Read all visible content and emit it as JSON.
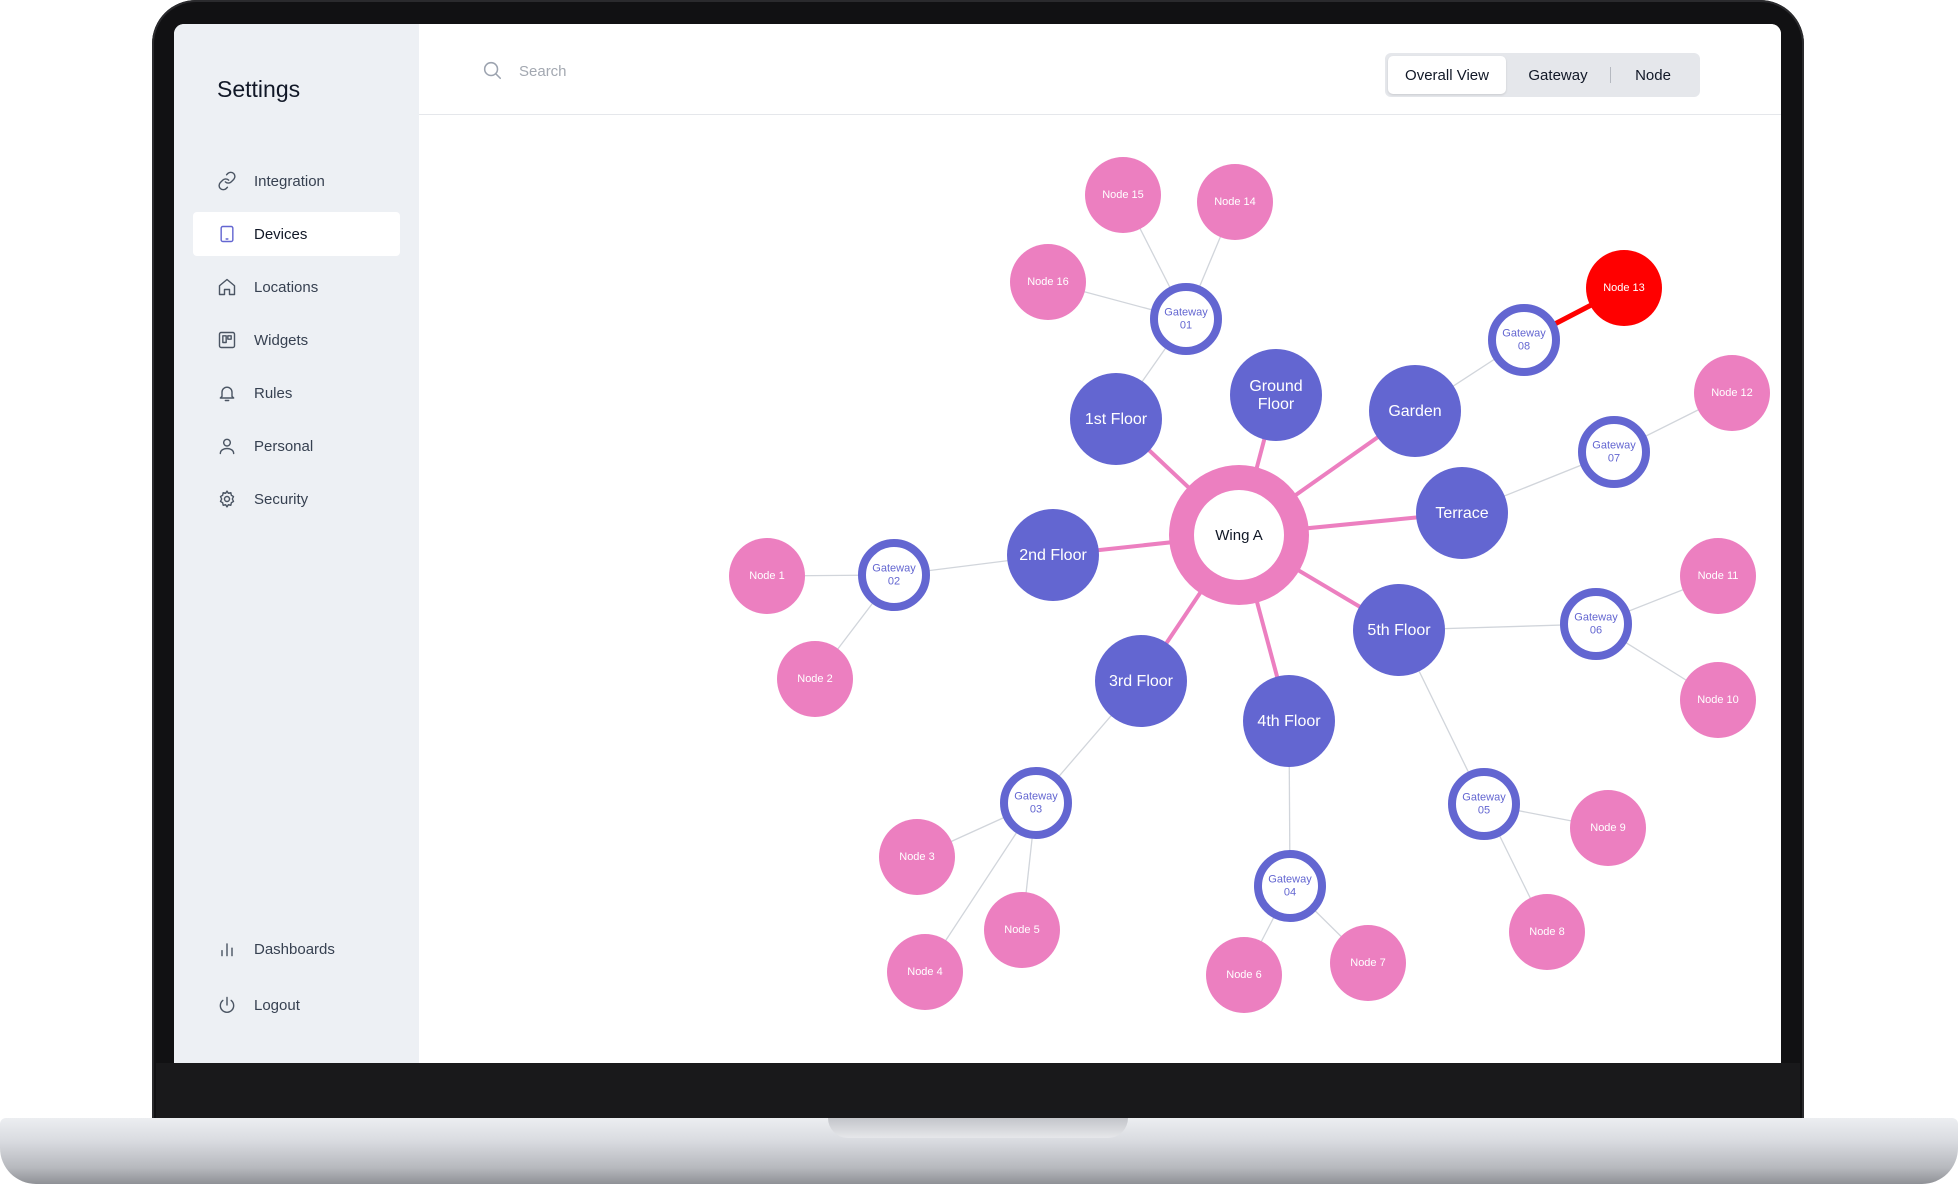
{
  "sidebar": {
    "title": "Settings",
    "items": [
      {
        "label": "Integration",
        "icon": "link-icon"
      },
      {
        "label": "Devices",
        "icon": "tablet-icon",
        "active": true
      },
      {
        "label": "Locations",
        "icon": "home-icon"
      },
      {
        "label": "Widgets",
        "icon": "widgets-icon"
      },
      {
        "label": "Rules",
        "icon": "bell-icon"
      },
      {
        "label": "Personal",
        "icon": "user-icon"
      },
      {
        "label": "Security",
        "icon": "gear-icon"
      }
    ],
    "bottom_items": [
      {
        "label": "Dashboards",
        "icon": "bar-chart-icon"
      },
      {
        "label": "Logout",
        "icon": "power-icon"
      }
    ]
  },
  "search": {
    "placeholder": "Search",
    "value": ""
  },
  "view_tabs": [
    {
      "label": "Overall View",
      "active": true
    },
    {
      "label": "Gateway",
      "active": false
    },
    {
      "label": "Node",
      "active": false
    }
  ],
  "colors": {
    "accent": "#6366D1",
    "hub": "#EC7FC0",
    "node": "#EC7FC0",
    "alert": "#FF0000",
    "sidebar_bg": "#EDF0F4"
  },
  "graph": {
    "hub": {
      "id": "wing-a",
      "label": "Wing A"
    },
    "areas": [
      {
        "id": "1st-floor",
        "lines": [
          "1st Floor"
        ]
      },
      {
        "id": "ground-floor",
        "lines": [
          "Ground",
          "Floor"
        ]
      },
      {
        "id": "garden",
        "lines": [
          "Garden"
        ]
      },
      {
        "id": "terrace",
        "lines": [
          "Terrace"
        ]
      },
      {
        "id": "5th-floor",
        "lines": [
          "5th Floor"
        ]
      },
      {
        "id": "4th-floor",
        "lines": [
          "4th Floor"
        ]
      },
      {
        "id": "3rd-floor",
        "lines": [
          "3rd Floor"
        ]
      },
      {
        "id": "2nd-floor",
        "lines": [
          "2nd Floor"
        ]
      }
    ],
    "gateways": [
      {
        "id": "gateway-01",
        "lines": [
          "Gateway",
          "01"
        ],
        "area": "1st-floor"
      },
      {
        "id": "gateway-02",
        "lines": [
          "Gateway",
          "02"
        ],
        "area": "2nd-floor"
      },
      {
        "id": "gateway-03",
        "lines": [
          "Gateway",
          "03"
        ],
        "area": "3rd-floor"
      },
      {
        "id": "gateway-04",
        "lines": [
          "Gateway",
          "04"
        ],
        "area": "4th-floor"
      },
      {
        "id": "gateway-05",
        "lines": [
          "Gateway",
          "05"
        ],
        "area": "5th-floor"
      },
      {
        "id": "gateway-06",
        "lines": [
          "Gateway",
          "06"
        ],
        "area": "5th-floor"
      },
      {
        "id": "gateway-07",
        "lines": [
          "Gateway",
          "07"
        ],
        "area": "terrace"
      },
      {
        "id": "gateway-08",
        "lines": [
          "Gateway",
          "08"
        ],
        "area": "garden"
      }
    ],
    "nodes": [
      {
        "id": "node-1",
        "label": "Node 1",
        "gateway": "gateway-02"
      },
      {
        "id": "node-2",
        "label": "Node 2",
        "gateway": "gateway-02"
      },
      {
        "id": "node-3",
        "label": "Node 3",
        "gateway": "gateway-03"
      },
      {
        "id": "node-4",
        "label": "Node 4",
        "gateway": "gateway-03"
      },
      {
        "id": "node-5",
        "label": "Node 5",
        "gateway": "gateway-03"
      },
      {
        "id": "node-6",
        "label": "Node 6",
        "gateway": "gateway-04"
      },
      {
        "id": "node-7",
        "label": "Node 7",
        "gateway": "gateway-04"
      },
      {
        "id": "node-8",
        "label": "Node 8",
        "gateway": "gateway-05"
      },
      {
        "id": "node-9",
        "label": "Node 9",
        "gateway": "gateway-05"
      },
      {
        "id": "node-10",
        "label": "Node 10",
        "gateway": "gateway-06"
      },
      {
        "id": "node-11",
        "label": "Node 11",
        "gateway": "gateway-06"
      },
      {
        "id": "node-12",
        "label": "Node 12",
        "gateway": "gateway-07"
      },
      {
        "id": "node-13",
        "label": "Node 13",
        "gateway": "gateway-08",
        "alert": true
      },
      {
        "id": "node-14",
        "label": "Node 14",
        "gateway": "gateway-01"
      },
      {
        "id": "node-15",
        "label": "Node 15",
        "gateway": "gateway-01"
      },
      {
        "id": "node-16",
        "label": "Node 16",
        "gateway": "gateway-01"
      }
    ]
  }
}
